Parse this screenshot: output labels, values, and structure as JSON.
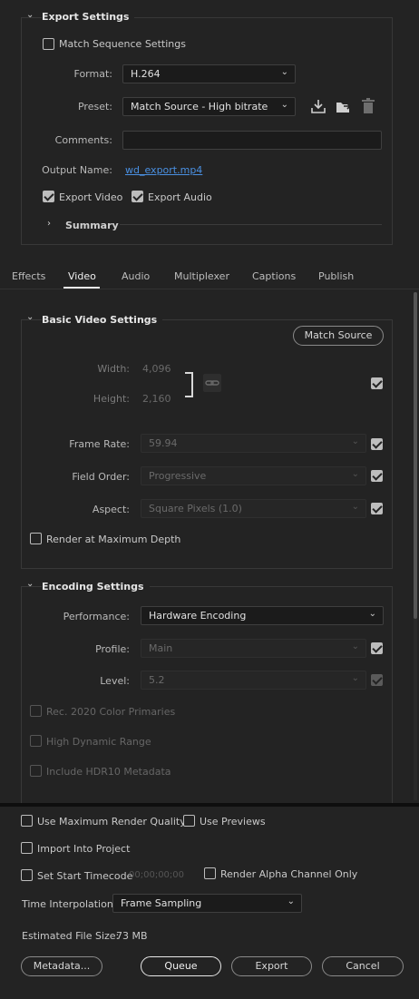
{
  "export_settings": {
    "title": "Export Settings",
    "match_sequence_label": "Match Sequence Settings",
    "match_sequence_checked": false,
    "format_label": "Format:",
    "format_value": "H.264",
    "preset_label": "Preset:",
    "preset_value": "Match Source - High bitrate",
    "comments_label": "Comments:",
    "comments_value": "",
    "output_name_label": "Output Name:",
    "output_name_value": "wd_export.mp4",
    "export_video_label": "Export Video",
    "export_video_checked": true,
    "export_audio_label": "Export Audio",
    "export_audio_checked": true,
    "summary_label": "Summary"
  },
  "tabs": [
    "Effects",
    "Video",
    "Audio",
    "Multiplexer",
    "Captions",
    "Publish"
  ],
  "active_tab": "Video",
  "basic_video": {
    "title": "Basic Video Settings",
    "match_source_button": "Match Source",
    "width_label": "Width:",
    "width_value": "4,096",
    "height_label": "Height:",
    "height_value": "2,160",
    "frame_rate_label": "Frame Rate:",
    "frame_rate_value": "59.94",
    "field_order_label": "Field Order:",
    "field_order_value": "Progressive",
    "aspect_label": "Aspect:",
    "aspect_value": "Square Pixels (1.0)",
    "render_max_depth_label": "Render at Maximum Depth"
  },
  "encoding": {
    "title": "Encoding Settings",
    "performance_label": "Performance:",
    "performance_value": "Hardware Encoding",
    "profile_label": "Profile:",
    "profile_value": "Main",
    "level_label": "Level:",
    "level_value": "5.2",
    "rec2020_label": "Rec. 2020 Color Primaries",
    "hdr_label": "High Dynamic Range",
    "hdr10_label": "Include HDR10 Metadata"
  },
  "bottom": {
    "max_render_quality_label": "Use Maximum Render Quality",
    "use_previews_label": "Use Previews",
    "import_project_label": "Import Into Project",
    "set_start_timecode_label": "Set Start Timecode",
    "timecode_value": "00;00;00;00",
    "render_alpha_label": "Render Alpha Channel Only",
    "time_interp_label": "Time Interpolation:",
    "time_interp_value": "Frame Sampling",
    "est_file_size_label": "Estimated File Size:",
    "est_file_size_value": "73 MB",
    "metadata_button": "Metadata...",
    "queue_button": "Queue",
    "export_button": "Export",
    "cancel_button": "Cancel"
  },
  "colors": {
    "background": "#232323",
    "link": "#4a90e2",
    "text": "#cfcfcf"
  }
}
